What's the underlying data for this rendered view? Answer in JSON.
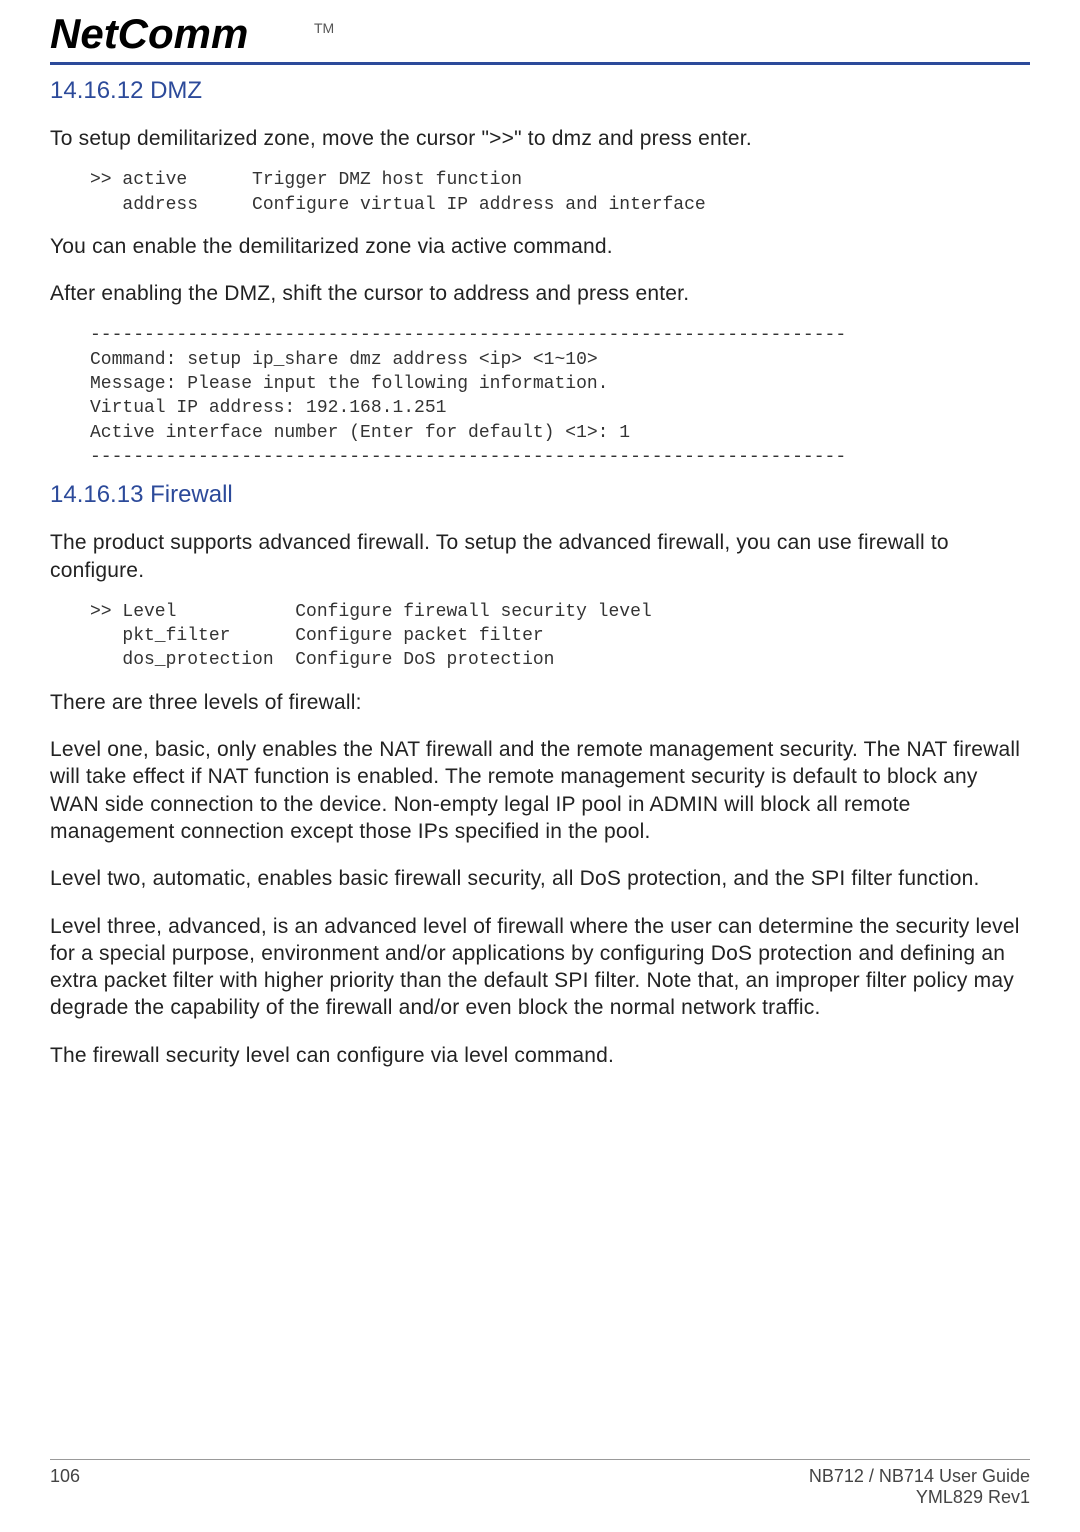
{
  "brand": {
    "name": "NetComm",
    "tm": "TM"
  },
  "sections": {
    "dmz": {
      "heading": "14.16.12 DMZ",
      "p1": "To setup demilitarized zone, move the cursor \">>\" to dmz and press enter.",
      "code1": ">> active      Trigger DMZ host function\n   address     Configure virtual IP address and interface",
      "p2": "You can enable the demilitarized zone via active command.",
      "p3": "After enabling the DMZ, shift the cursor to address and press enter.",
      "code2": "----------------------------------------------------------------------\nCommand: setup ip_share dmz address <ip> <1~10>\nMessage: Please input the following information.\nVirtual IP address: 192.168.1.251\nActive interface number (Enter for default) <1>: 1\n----------------------------------------------------------------------"
    },
    "firewall": {
      "heading": "14.16.13 Firewall",
      "p1": "The product supports advanced firewall. To setup the advanced firewall, you can use firewall to configure.",
      "code1": ">> Level           Configure firewall security level\n   pkt_filter      Configure packet filter\n   dos_protection  Configure DoS protection",
      "p2": "There are three levels of firewall:",
      "p3": "Level one, basic, only enables the NAT firewall and the remote management security. The NAT firewall will take effect if NAT function is enabled. The remote management security is default to block any WAN side connection to the device. Non-empty legal IP pool in ADMIN will block all remote management connection except those IPs specified in the pool.",
      "p4": "Level two, automatic, enables basic firewall security, all DoS protection, and the SPI filter function.",
      "p5": "Level three, advanced, is an advanced level of firewall where the user can determine the security level for a special purpose, environment and/or applications by configuring DoS protection and defining an extra packet filter with higher priority than the default SPI filter. Note that, an improper filter policy may degrade the capability of the firewall and/or even block the normal network traffic.",
      "p6": "The firewall security level can configure via level command."
    }
  },
  "footer": {
    "page": "106",
    "guide": "NB712 / NB714 User Guide",
    "rev": "YML829 Rev1"
  }
}
